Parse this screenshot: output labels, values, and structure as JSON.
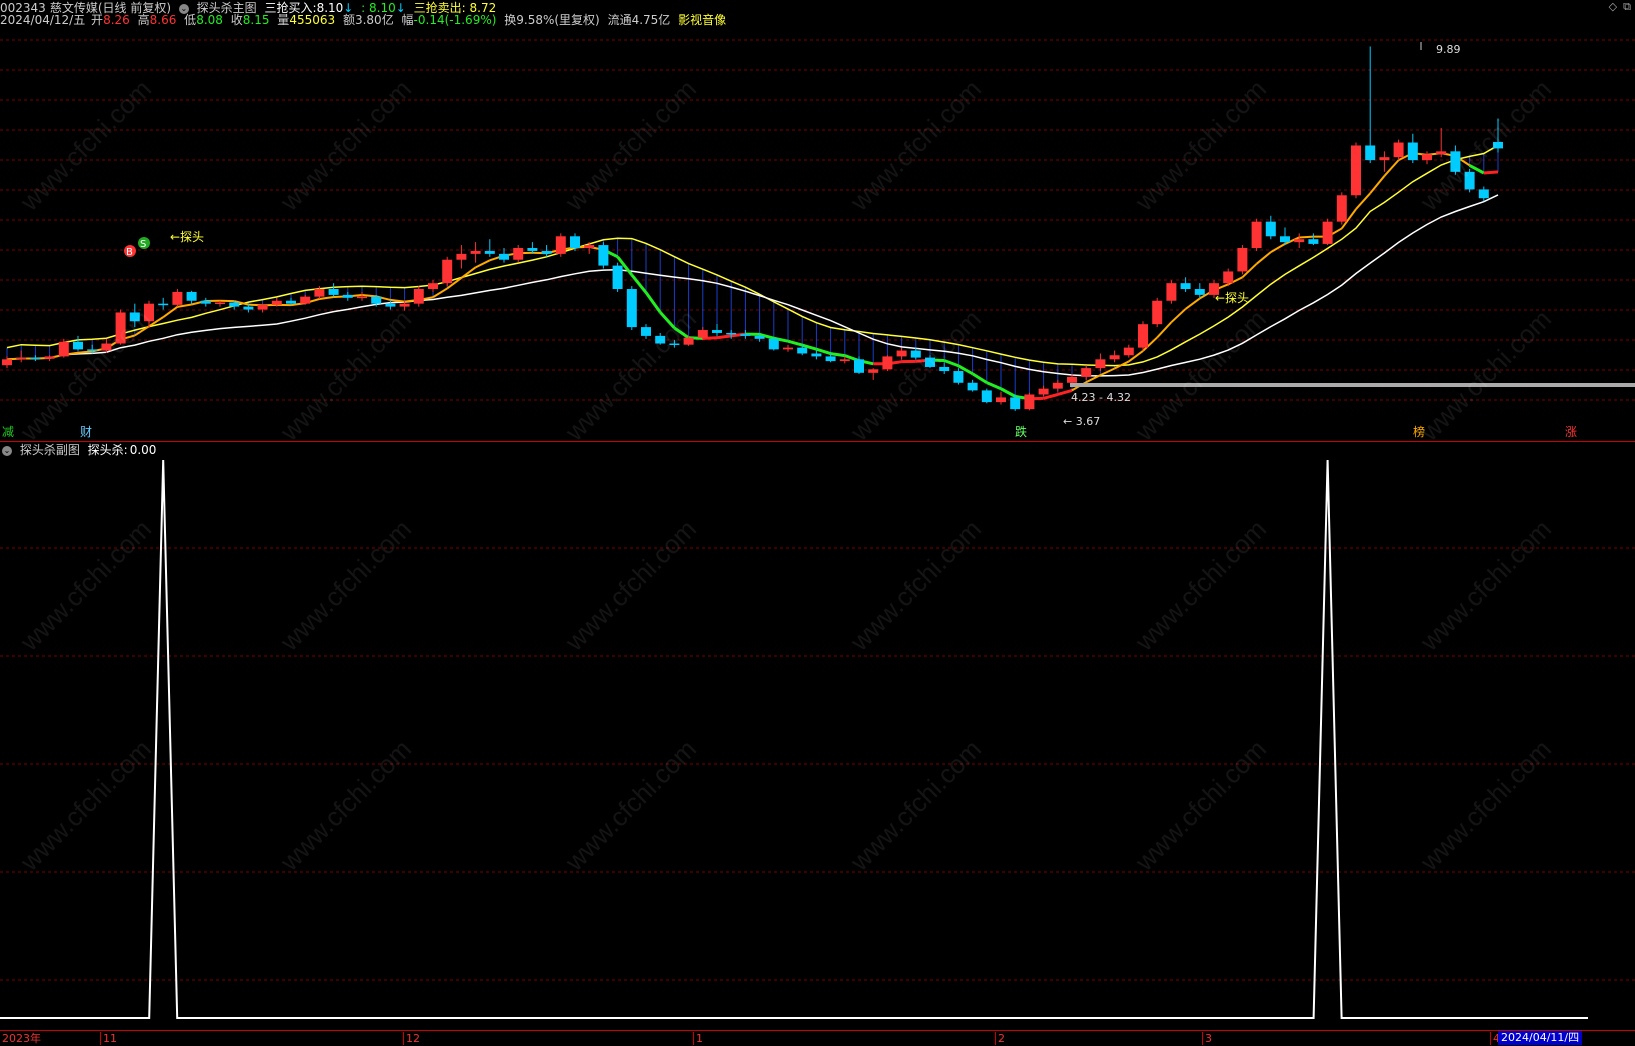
{
  "header": {
    "code": "002343",
    "name": "慈文传媒",
    "period": "(日线 前复权)",
    "indicator_main": "探头杀主图",
    "buy_label": "三抢买入:",
    "buy_value": "8.10",
    "buy_value2": ": 8.10",
    "sell_label": "三抢卖出:",
    "sell_value": "8.72"
  },
  "quote": {
    "date": "2024/04/12/五",
    "open_label": "开",
    "open": "8.26",
    "high_label": "高",
    "high": "8.66",
    "low_label": "低",
    "low": "8.08",
    "close_label": "收",
    "close": "8.15",
    "vol_label": "量",
    "vol": "455063",
    "amount_label": "额",
    "amount": "3.80亿",
    "change_label": "幅",
    "change": "-0.14(-1.69%)",
    "turnover": "换9.58%(里复权)",
    "float": "流通4.75亿",
    "concept": "影视音像"
  },
  "annotations": {
    "probe1": "←探头",
    "probe2": "←探头",
    "high_label": "9.89",
    "low_label": "3.67",
    "range_label": "4.23 - 4.32",
    "b_mark": "B",
    "s_mark": "S"
  },
  "events": [
    {
      "text": "减",
      "color": "#22cc22"
    },
    {
      "text": "财",
      "color": "#66ccff"
    },
    {
      "text": "跌",
      "color": "#66ff66"
    },
    {
      "text": "榜",
      "color": "#ffaa00"
    },
    {
      "text": "涨",
      "color": "#ff3333"
    }
  ],
  "sub": {
    "title": "探头杀副图",
    "value_label": "探头杀:",
    "value": "0.00"
  },
  "xaxis": {
    "labels": [
      "2023年",
      "11",
      "12",
      "1",
      "2",
      "3",
      "4"
    ],
    "end_date": "2024/04/11/四"
  },
  "watermark": "www.cfchi.com",
  "colors": {
    "up": "#ff3333",
    "down": "#00ccff",
    "ma_yellow": "#ffff33",
    "ma_white": "#ffffff",
    "trend_green": "#22ee22",
    "trend_red": "#ff2222",
    "trend_orange": "#ffaa00",
    "grid": "#7a0000"
  },
  "chart_data": [
    {
      "type": "candlestick",
      "title": "探头杀主图",
      "ylim": [
        3.6,
        10.0
      ],
      "candles": [
        [
          4.45,
          4.6,
          4.4,
          4.55
        ],
        [
          4.55,
          4.7,
          4.5,
          4.58
        ],
        [
          4.58,
          4.62,
          4.52,
          4.56
        ],
        [
          4.56,
          4.62,
          4.52,
          4.6
        ],
        [
          4.6,
          4.9,
          4.58,
          4.85
        ],
        [
          4.85,
          4.95,
          4.7,
          4.72
        ],
        [
          4.72,
          4.8,
          4.65,
          4.7
        ],
        [
          4.7,
          4.9,
          4.66,
          4.82
        ],
        [
          4.82,
          5.4,
          4.8,
          5.35
        ],
        [
          5.35,
          5.5,
          5.1,
          5.2
        ],
        [
          5.2,
          5.55,
          5.1,
          5.5
        ],
        [
          5.5,
          5.6,
          5.4,
          5.48
        ],
        [
          5.48,
          5.75,
          5.45,
          5.7
        ],
        [
          5.7,
          5.72,
          5.5,
          5.55
        ],
        [
          5.55,
          5.6,
          5.45,
          5.5
        ],
        [
          5.5,
          5.55,
          5.45,
          5.52
        ],
        [
          5.52,
          5.55,
          5.4,
          5.45
        ],
        [
          5.45,
          5.5,
          5.35,
          5.4
        ],
        [
          5.4,
          5.5,
          5.35,
          5.48
        ],
        [
          5.48,
          5.6,
          5.45,
          5.55
        ],
        [
          5.55,
          5.6,
          5.48,
          5.5
        ],
        [
          5.5,
          5.65,
          5.48,
          5.62
        ],
        [
          5.62,
          5.8,
          5.58,
          5.75
        ],
        [
          5.75,
          5.85,
          5.62,
          5.65
        ],
        [
          5.65,
          5.7,
          5.55,
          5.6
        ],
        [
          5.6,
          5.7,
          5.55,
          5.62
        ],
        [
          5.62,
          5.65,
          5.45,
          5.5
        ],
        [
          5.5,
          5.55,
          5.4,
          5.45
        ],
        [
          5.45,
          5.55,
          5.38,
          5.5
        ],
        [
          5.5,
          5.8,
          5.45,
          5.75
        ],
        [
          5.75,
          5.9,
          5.7,
          5.85
        ],
        [
          5.85,
          6.3,
          5.8,
          6.25
        ],
        [
          6.25,
          6.5,
          6.1,
          6.35
        ],
        [
          6.35,
          6.55,
          6.2,
          6.4
        ],
        [
          6.4,
          6.6,
          6.3,
          6.35
        ],
        [
          6.35,
          6.45,
          6.2,
          6.25
        ],
        [
          6.25,
          6.5,
          6.2,
          6.45
        ],
        [
          6.45,
          6.55,
          6.35,
          6.4
        ],
        [
          6.4,
          6.5,
          6.3,
          6.35
        ],
        [
          6.35,
          6.7,
          6.3,
          6.65
        ],
        [
          6.65,
          6.7,
          6.4,
          6.45
        ],
        [
          6.45,
          6.55,
          6.35,
          6.5
        ],
        [
          6.5,
          6.55,
          6.1,
          6.15
        ],
        [
          6.15,
          6.2,
          5.7,
          5.75
        ],
        [
          5.75,
          5.8,
          5.05,
          5.1
        ],
        [
          5.1,
          5.15,
          4.9,
          4.95
        ],
        [
          4.95,
          5.0,
          4.8,
          4.82
        ],
        [
          4.82,
          4.88,
          4.75,
          4.8
        ],
        [
          4.8,
          4.95,
          4.78,
          4.92
        ],
        [
          4.92,
          5.1,
          4.88,
          5.05
        ],
        [
          5.05,
          5.15,
          4.95,
          5.0
        ],
        [
          5.0,
          5.05,
          4.9,
          4.98
        ],
        [
          4.98,
          5.05,
          4.9,
          4.95
        ],
        [
          4.95,
          5.0,
          4.85,
          4.9
        ],
        [
          4.9,
          4.92,
          4.7,
          4.72
        ],
        [
          4.72,
          4.8,
          4.68,
          4.75
        ],
        [
          4.75,
          4.8,
          4.62,
          4.65
        ],
        [
          4.65,
          4.7,
          4.55,
          4.6
        ],
        [
          4.6,
          4.65,
          4.5,
          4.52
        ],
        [
          4.52,
          4.6,
          4.48,
          4.55
        ],
        [
          4.55,
          4.6,
          4.3,
          4.32
        ],
        [
          4.32,
          4.4,
          4.2,
          4.38
        ],
        [
          4.38,
          4.62,
          4.35,
          4.6
        ],
        [
          4.6,
          4.75,
          4.55,
          4.7
        ],
        [
          4.7,
          4.75,
          4.55,
          4.58
        ],
        [
          4.58,
          4.62,
          4.4,
          4.42
        ],
        [
          4.42,
          4.5,
          4.3,
          4.35
        ],
        [
          4.35,
          4.4,
          4.12,
          4.15
        ],
        [
          4.15,
          4.2,
          4.0,
          4.02
        ],
        [
          4.02,
          4.05,
          3.8,
          3.82
        ],
        [
          3.82,
          4.0,
          3.78,
          3.9
        ],
        [
          3.9,
          3.95,
          3.67,
          3.7
        ],
        [
          3.7,
          3.98,
          3.68,
          3.95
        ],
        [
          3.95,
          4.1,
          3.92,
          4.05
        ],
        [
          4.05,
          4.2,
          4.0,
          4.15
        ],
        [
          4.15,
          4.3,
          4.1,
          4.25
        ],
        [
          4.25,
          4.45,
          4.2,
          4.4
        ],
        [
          4.4,
          4.65,
          4.35,
          4.55
        ],
        [
          4.55,
          4.7,
          4.5,
          4.62
        ],
        [
          4.62,
          4.8,
          4.58,
          4.75
        ],
        [
          4.75,
          5.2,
          4.7,
          5.15
        ],
        [
          5.15,
          5.6,
          5.1,
          5.55
        ],
        [
          5.55,
          5.9,
          5.5,
          5.85
        ],
        [
          5.85,
          5.95,
          5.7,
          5.75
        ],
        [
          5.75,
          5.85,
          5.6,
          5.65
        ],
        [
          5.65,
          5.9,
          5.6,
          5.85
        ],
        [
          5.85,
          6.1,
          5.8,
          6.05
        ],
        [
          6.05,
          6.5,
          6.0,
          6.45
        ],
        [
          6.45,
          6.95,
          6.4,
          6.9
        ],
        [
          6.9,
          7.0,
          6.6,
          6.65
        ],
        [
          6.65,
          6.8,
          6.5,
          6.55
        ],
        [
          6.55,
          6.7,
          6.45,
          6.6
        ],
        [
          6.6,
          6.7,
          6.5,
          6.52
        ],
        [
          6.52,
          6.95,
          6.5,
          6.9
        ],
        [
          6.9,
          7.4,
          6.85,
          7.35
        ],
        [
          7.35,
          8.25,
          7.3,
          8.2
        ],
        [
          8.2,
          9.89,
          7.9,
          7.95
        ],
        [
          7.95,
          8.1,
          7.75,
          8.0
        ],
        [
          8.0,
          8.3,
          7.95,
          8.25
        ],
        [
          8.25,
          8.4,
          7.9,
          7.95
        ],
        [
          7.95,
          8.1,
          7.88,
          8.05
        ],
        [
          8.05,
          8.5,
          8.0,
          8.1
        ],
        [
          8.1,
          8.2,
          7.7,
          7.75
        ],
        [
          7.75,
          7.8,
          7.4,
          7.45
        ],
        [
          7.45,
          7.5,
          7.25,
          7.3
        ],
        [
          8.26,
          8.66,
          8.08,
          8.15
        ]
      ]
    },
    {
      "type": "line",
      "title": "探头杀副图",
      "series": [
        {
          "name": "探头杀",
          "spikes_at_candle": [
            11,
            93
          ]
        }
      ]
    }
  ]
}
